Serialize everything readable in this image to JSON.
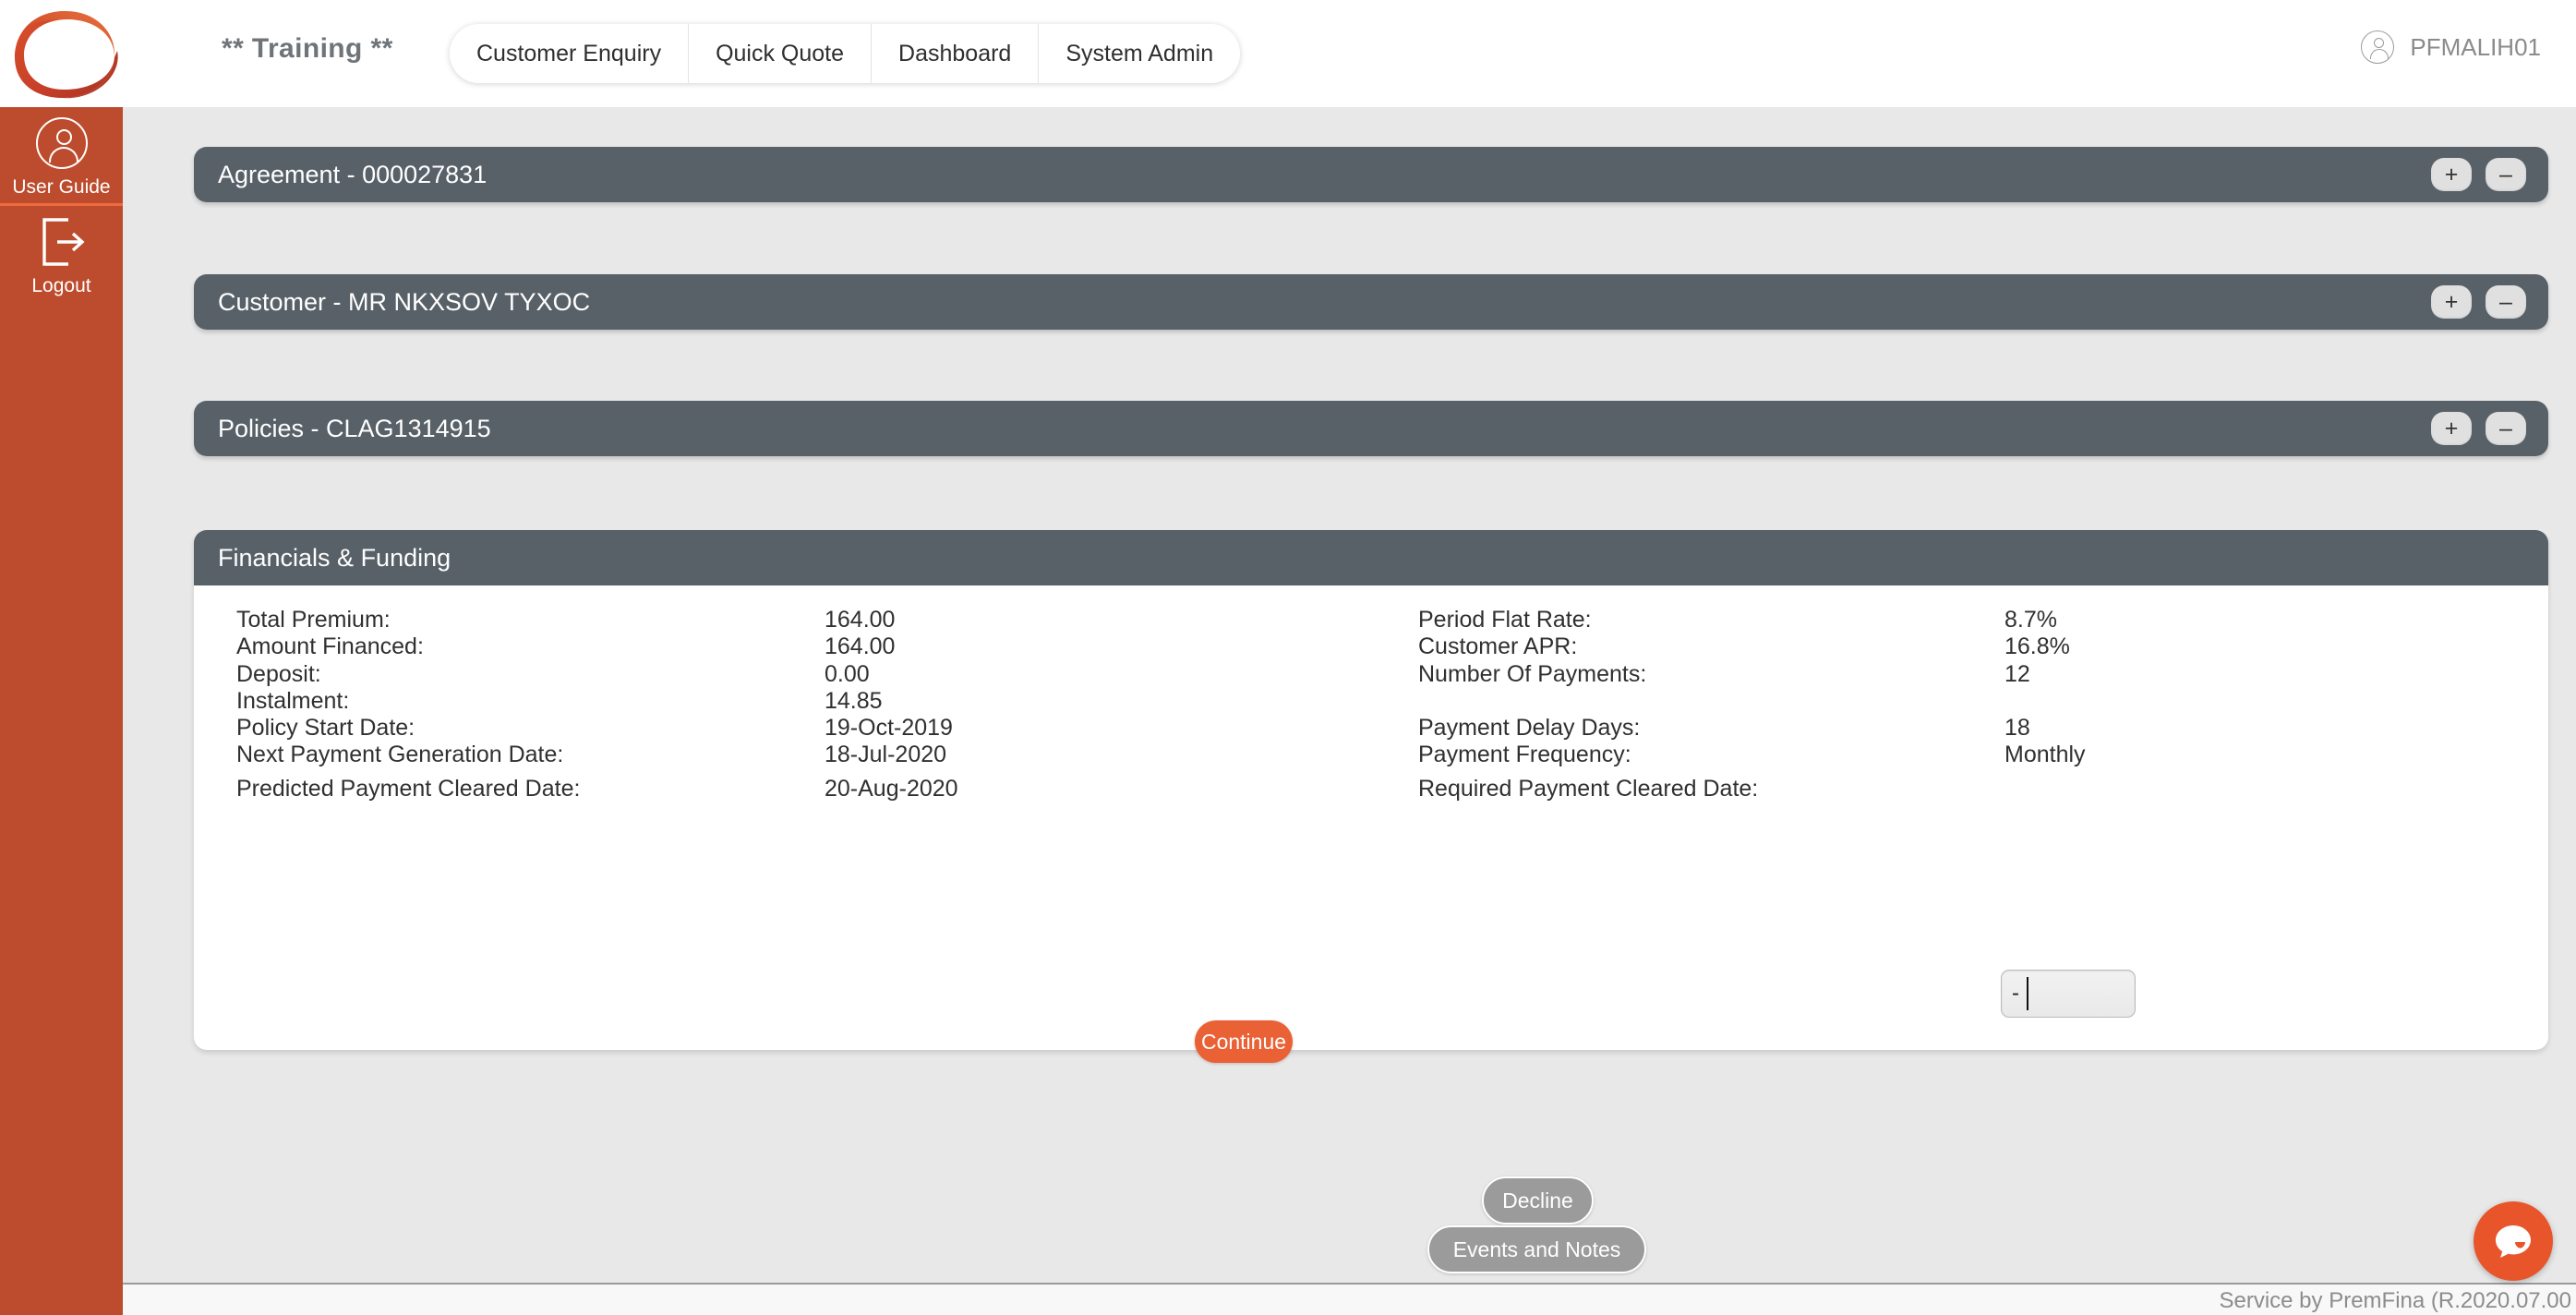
{
  "header": {
    "brand_title": "** Training **",
    "logo_name": "premfina-logo",
    "tabs": [
      {
        "label": "Customer Enquiry"
      },
      {
        "label": "Quick Quote"
      },
      {
        "label": "Dashboard"
      },
      {
        "label": "System Admin"
      }
    ],
    "user": {
      "name": "PFMALIH01",
      "icon": "user-circle-icon"
    }
  },
  "sidebar": {
    "items": [
      {
        "label": "User Guide",
        "icon": "user-circle-icon"
      },
      {
        "label": "Logout",
        "icon": "logout-arrow-icon"
      }
    ]
  },
  "panels": {
    "agreement": {
      "title": "Agreement - 000027831",
      "expand_label": "+",
      "collapse_label": "–"
    },
    "customer": {
      "title": "Customer - MR NKXSOV TYXOC",
      "expand_label": "+",
      "collapse_label": "–"
    },
    "policies": {
      "title": "Policies - CLAG1314915",
      "expand_label": "+",
      "collapse_label": "–"
    },
    "financials": {
      "title": "Financials & Funding",
      "left_fields": [
        {
          "label": "Total Premium:",
          "value": "164.00"
        },
        {
          "label": "Amount Financed:",
          "value": "164.00"
        },
        {
          "label": "Deposit:",
          "value": "0.00"
        },
        {
          "label": "Instalment:",
          "value": "14.85"
        },
        {
          "label": "Policy Start Date:",
          "value": "19-Oct-2019"
        },
        {
          "label": "Next Payment Generation Date:",
          "value": "18-Jul-2020"
        },
        {
          "label": "Predicted Payment Cleared Date:",
          "value": "20-Aug-2020"
        }
      ],
      "right_fields": [
        {
          "label": "Period Flat Rate:",
          "value": "8.7%"
        },
        {
          "label": "Customer APR:",
          "value": "16.8%"
        },
        {
          "label": "Number Of Payments:",
          "value": "12"
        },
        {
          "label": "Payment Delay Days:",
          "value": "18"
        },
        {
          "label": "Payment Frequency:",
          "value": "Monthly"
        }
      ],
      "required_cleared_date": {
        "label": "Required Payment Cleared Date:",
        "value": "-",
        "placeholder": ""
      },
      "continue_label": "Continue"
    }
  },
  "actions": {
    "decline_label": "Decline",
    "events_label": "Events and Notes"
  },
  "footer": {
    "text": "Service by PremFina (R.2020.07.00"
  },
  "chat": {
    "icon": "chat-bubble-icon"
  },
  "colors": {
    "brand_orange": "#e9552a",
    "sidebar_orange": "#bc4c2d",
    "panel_header": "#586168",
    "page_bg": "#e8e8e8"
  }
}
